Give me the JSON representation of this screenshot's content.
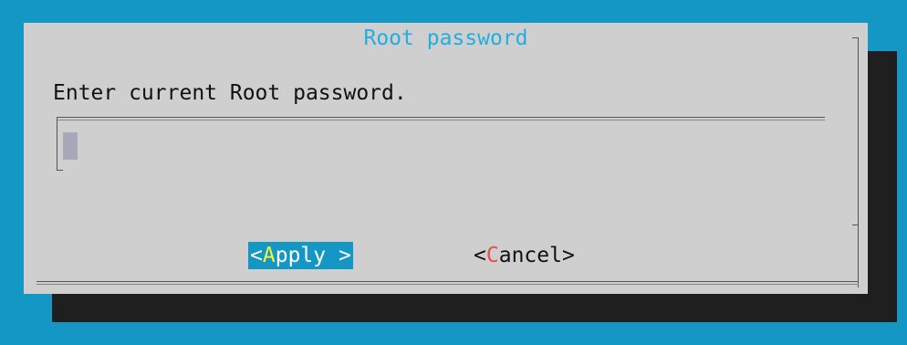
{
  "dialog": {
    "title": "Root password",
    "prompt": "Enter current Root password.",
    "password_value": ""
  },
  "buttons": {
    "apply": {
      "open": "<",
      "hotkey": "A",
      "rest": "pply",
      "close": " >"
    },
    "cancel": {
      "open": "<",
      "hotkey": "C",
      "rest": "ancel",
      "close": ">"
    }
  },
  "colors": {
    "background": "#1497c4",
    "dialog": "#cfcfcf",
    "shadow": "#1f1f1f",
    "title": "#22aee0",
    "hotkey_focused": "#f6f23c",
    "hotkey": "#e8504a"
  }
}
